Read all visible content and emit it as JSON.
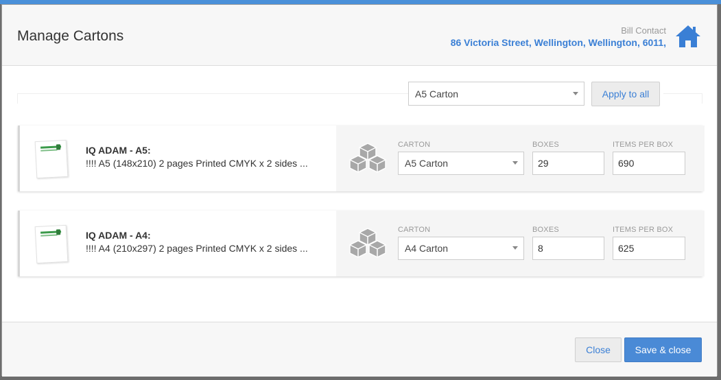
{
  "modal": {
    "title": "Manage Cartons"
  },
  "bill_contact": {
    "label": "Bill Contact",
    "address": "86 Victoria Street, Wellington, Wellington, 6011,",
    "icon": "home-icon"
  },
  "toolbar": {
    "carton_select": "A5 Carton",
    "apply_label": "Apply to all"
  },
  "labels": {
    "carton": "CARTON",
    "boxes": "BOXES",
    "items_per_box": "ITEMS PER BOX"
  },
  "products": [
    {
      "title": "IQ ADAM - A5:",
      "description": "!!!! A5 (148x210) 2 pages Printed CMYK x 2 sides ...",
      "carton": "A5 Carton",
      "boxes": "29",
      "items_per_box": "690"
    },
    {
      "title": "IQ ADAM - A4:",
      "description": "!!!! A4 (210x297) 2 pages Printed CMYK x 2 sides ...",
      "carton": "A4 Carton",
      "boxes": "8",
      "items_per_box": "625"
    }
  ],
  "footer": {
    "close_label": "Close",
    "save_label": "Save & close"
  },
  "colors": {
    "accent": "#3a7fd5",
    "primary_button": "#4a8ad6",
    "icon_gray": "#9a9a9a"
  }
}
